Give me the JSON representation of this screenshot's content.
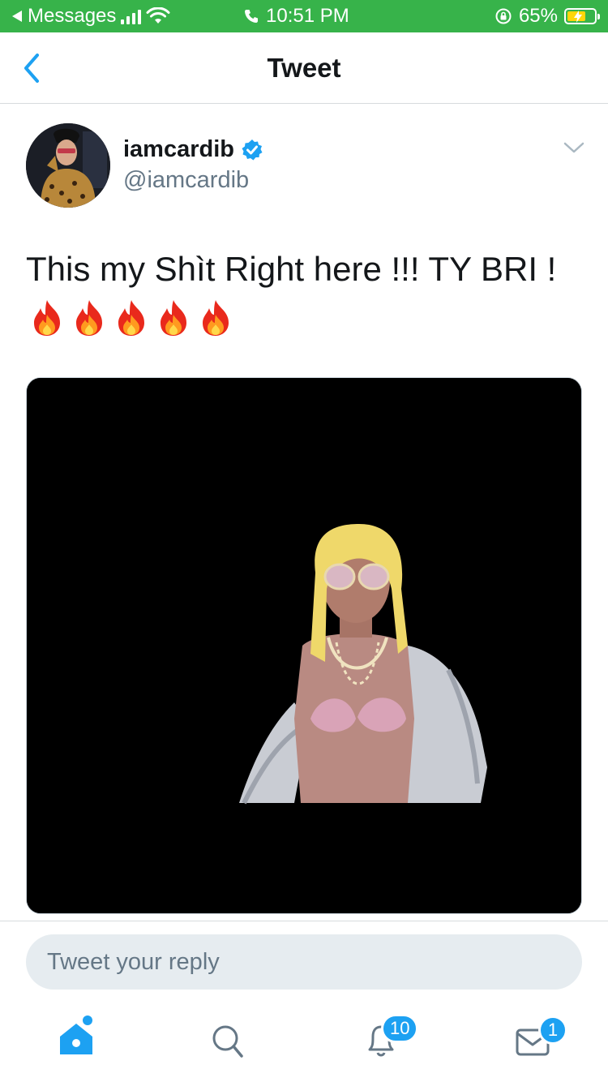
{
  "status_bar": {
    "back_app": "Messages",
    "time": "10:51 PM",
    "battery": "65%"
  },
  "nav": {
    "title": "Tweet"
  },
  "tweet": {
    "author_name": "iamcardib",
    "author_handle": "@iamcardib",
    "text": "This my Shìt Right here !!! TY BRI !",
    "emojis": [
      "🔥",
      "🔥",
      "🔥",
      "🔥",
      "🔥"
    ]
  },
  "reply": {
    "placeholder": "Tweet your reply"
  },
  "tab_bar": {
    "notifications_count": "10",
    "messages_count": "1"
  },
  "colors": {
    "status_bar_bg": "#37b34a",
    "accent": "#1da1f2",
    "secondary_text": "#657786"
  },
  "icons": [
    "back-chevron-icon",
    "signal-icon",
    "wifi-icon",
    "phone-icon",
    "rotation-lock-icon",
    "battery-icon",
    "verified-badge-icon",
    "chevron-down-icon",
    "home-icon",
    "search-icon",
    "bell-icon",
    "mail-icon",
    "fire-emoji"
  ]
}
